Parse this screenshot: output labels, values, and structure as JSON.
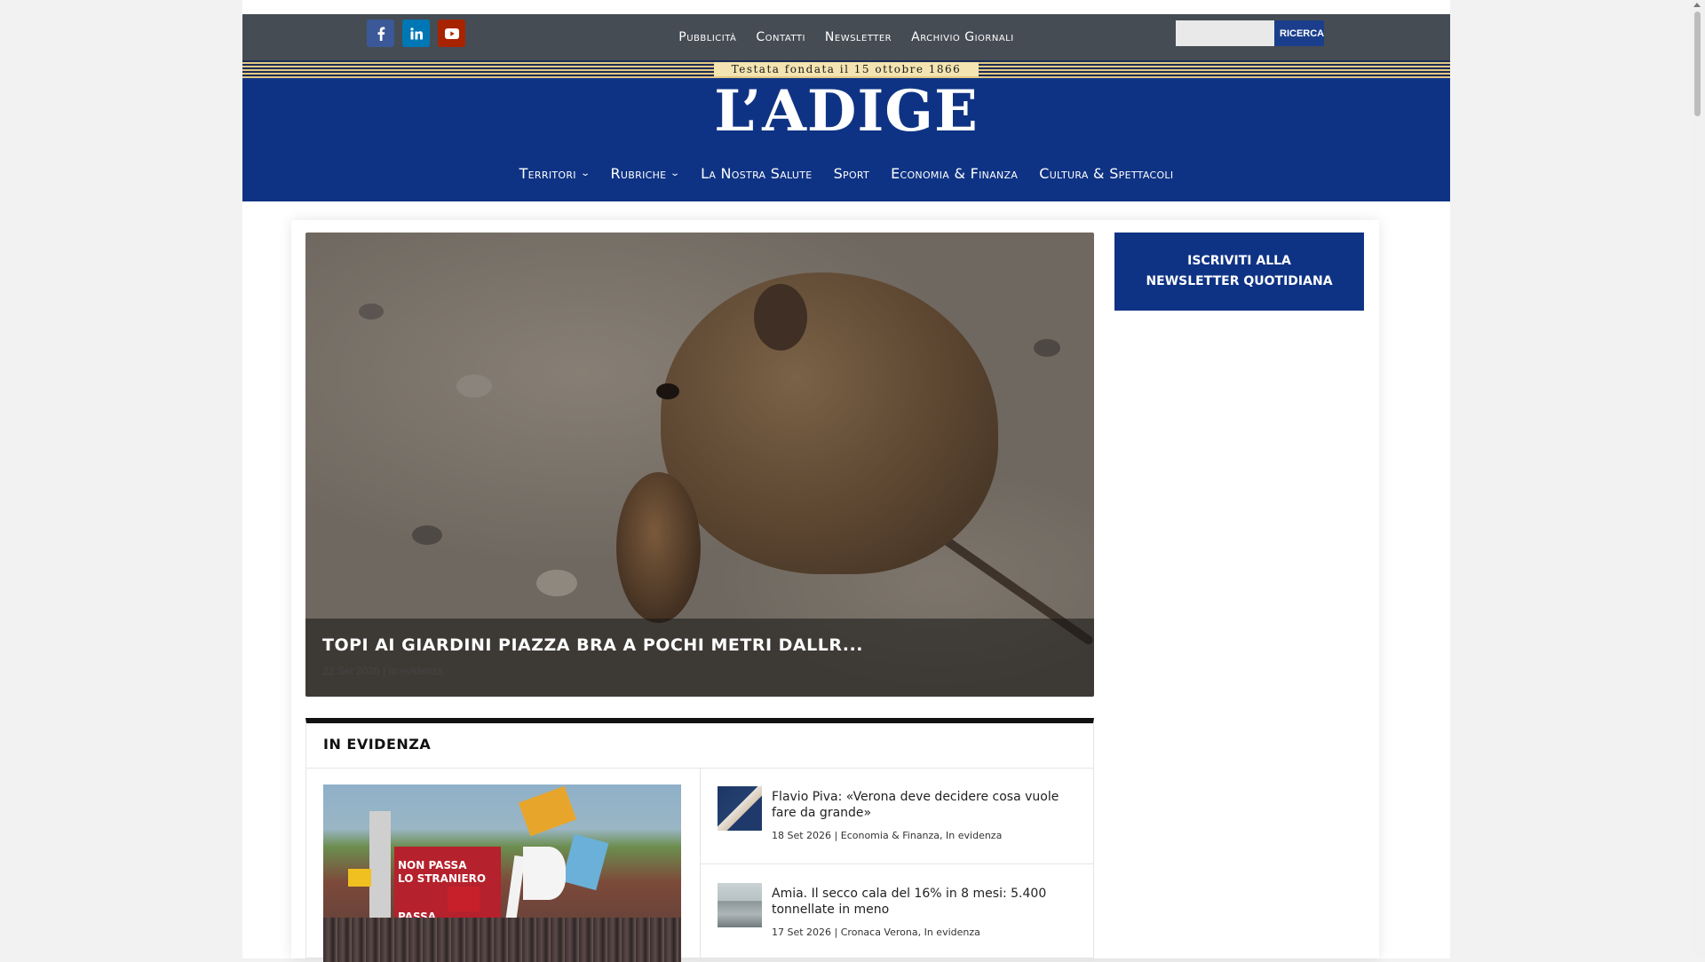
{
  "social": {
    "facebook": "f",
    "linkedin": "in"
  },
  "topnav": {
    "items": [
      "Pubblicità",
      "Contatti",
      "Newsletter",
      "Archivio Giornali"
    ]
  },
  "search": {
    "value": "",
    "button_label": "RICERCA"
  },
  "tagline": "Testata fondata il 15 ottobre 1866",
  "logo": "L’ADIGE",
  "mainnav": {
    "items": [
      {
        "label": "Territori",
        "has_dropdown": true
      },
      {
        "label": "Rubriche",
        "has_dropdown": true
      },
      {
        "label": "La Nostra Salute",
        "has_dropdown": false
      },
      {
        "label": "Sport",
        "has_dropdown": false
      },
      {
        "label": "Economia & Finanza",
        "has_dropdown": false
      },
      {
        "label": "Cultura & Spettacoli",
        "has_dropdown": false
      }
    ],
    "dropdown_icon": "chevron-down-icon"
  },
  "hero": {
    "title": "TOPI AI GIARDINI PIAZZA BRA A POCHI METRI DALLR...",
    "date": "22 Set 2026",
    "separator": "|",
    "category": "In evidenza"
  },
  "newsletter": {
    "line1": "ISCRIVITI ALLA",
    "line2": "NEWSLETTER QUOTIDIANA"
  },
  "evidenza": {
    "heading": "IN EVIDENZA",
    "photo_text": {
      "line1": "NON PASSA",
      "line2": "LO STRANIERO",
      "line3": "PASSA"
    },
    "items": [
      {
        "title": "Flavio Piva: «Verona deve decidere cosa vuole fare da grande»",
        "meta": "18 Set 2026 | Economia & Finanza, In evidenza"
      },
      {
        "title": "Amia. Il secco cala del 16% in 8 mesi: 5.400 tonnellate in meno",
        "meta": "17 Set 2026 | Cronaca Verona, In evidenza"
      }
    ]
  },
  "colors": {
    "brand_blue": "#0f3384",
    "topbar_gray": "#464c54",
    "facebook": "#3b5998",
    "linkedin": "#0077b5",
    "youtube": "#a82400"
  }
}
